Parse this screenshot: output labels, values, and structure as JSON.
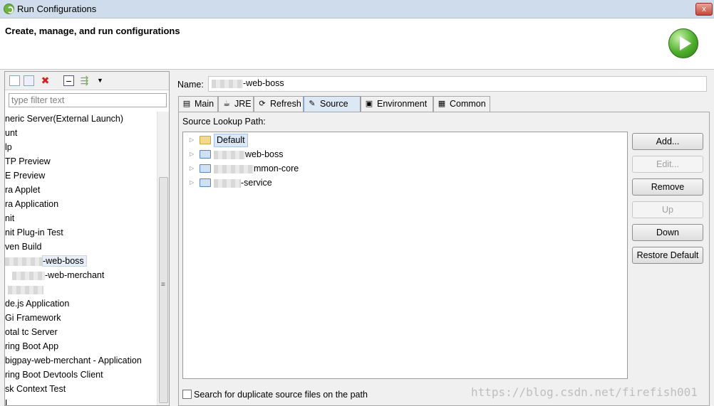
{
  "window": {
    "title": "Run Configurations",
    "close_glyph": "x"
  },
  "banner": {
    "heading": "Create, manage, and run configurations"
  },
  "left": {
    "filter_placeholder": "type filter text",
    "items": [
      "neric Server(External Launch)",
      "unt",
      "lp",
      "TP Preview",
      "E Preview",
      "ra Applet",
      "ra Application",
      "nit",
      "nit Plug-in Test",
      "ven Build",
      "-web-boss",
      "-web-merchant",
      "",
      "de.js Application",
      "Gi Framework",
      "otal tc Server",
      "ring Boot App",
      "bigpay-web-merchant - Application",
      "ring Boot Devtools Client",
      "sk Context Test",
      "L"
    ]
  },
  "right": {
    "name_label": "Name:",
    "name_value": "-web-boss",
    "tabs": [
      "Main",
      "JRE",
      "Refresh",
      "Source",
      "Environment",
      "Common"
    ],
    "lookup_label": "Source Lookup Path:",
    "lookup_items": [
      "Default",
      "web-boss",
      "mmon-core",
      "-service"
    ],
    "buttons": {
      "add": "Add...",
      "edit": "Edit...",
      "remove": "Remove",
      "up": "Up",
      "down": "Down",
      "restore": "Restore Default"
    },
    "dup_check_label": "Search for duplicate source files on the path"
  },
  "watermark": "https://blog.csdn.net/firefish001"
}
